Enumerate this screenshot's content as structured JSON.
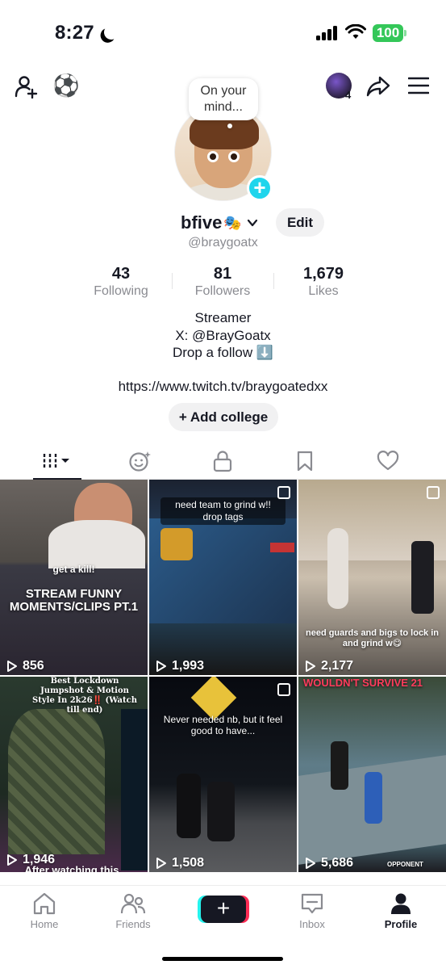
{
  "status_bar": {
    "time": "8:27",
    "battery": "100"
  },
  "header": {
    "notification_count": "4"
  },
  "profile": {
    "bubble_text": "On your mind...",
    "display_name": "bfive",
    "name_emoji": "🎭",
    "edit_label": "Edit",
    "username": "@braygoatx",
    "stats": [
      {
        "value": "43",
        "label": "Following"
      },
      {
        "value": "81",
        "label": "Followers"
      },
      {
        "value": "1,679",
        "label": "Likes"
      }
    ],
    "bio_lines": [
      "Streamer",
      "X: @BrayGoatx",
      "Drop a follow ⬇️"
    ],
    "link": "https://www.twitch.tv/braygoatedxx",
    "add_college_label": "+ Add college"
  },
  "tabs": [
    "videos",
    "reposts",
    "private",
    "favorites",
    "liked"
  ],
  "videos": [
    {
      "views": "856",
      "caption": "STREAM FUNNY MOMENTS/CLIPS PT.1",
      "top_text": "get a kill!",
      "colors": [
        "#5a5550",
        "#2c2a33",
        "#6b5a52"
      ]
    },
    {
      "views": "1,993",
      "caption": "need team to grind w!! drop tags",
      "colors": [
        "#1f2a3a",
        "#2a4e7a",
        "#1b1b20"
      ]
    },
    {
      "views": "2,177",
      "caption": "need guards and bigs to lock in and grind w😋",
      "colors": [
        "#8a7a6a",
        "#d9cfc3",
        "#3d3a38"
      ]
    },
    {
      "views": "1,946",
      "caption": "Best Lockdown Jumpshot & Motion Style In 2k26‼️ (Watch till end)",
      "bottom_text": "After watching this",
      "colors": [
        "#1a3a2a",
        "#2b2b22",
        "#1a1410"
      ]
    },
    {
      "views": "1,508",
      "caption": "Never needed nb, but it feel good to have...",
      "colors": [
        "#0b0d12",
        "#1a1e24",
        "#3a3c40"
      ]
    },
    {
      "views": "5,686",
      "caption": "WOULDN'T SURVIVE 21",
      "bottom_text": "OPPONENT",
      "colors": [
        "#3b4a3a",
        "#5e7a8a",
        "#2a2b30"
      ]
    }
  ],
  "bottom_nav": [
    {
      "label": "Home",
      "icon": "home-icon"
    },
    {
      "label": "Friends",
      "icon": "friends-icon"
    },
    {
      "label": "",
      "icon": "create-icon"
    },
    {
      "label": "Inbox",
      "icon": "inbox-icon"
    },
    {
      "label": "Profile",
      "icon": "profile-icon"
    }
  ]
}
